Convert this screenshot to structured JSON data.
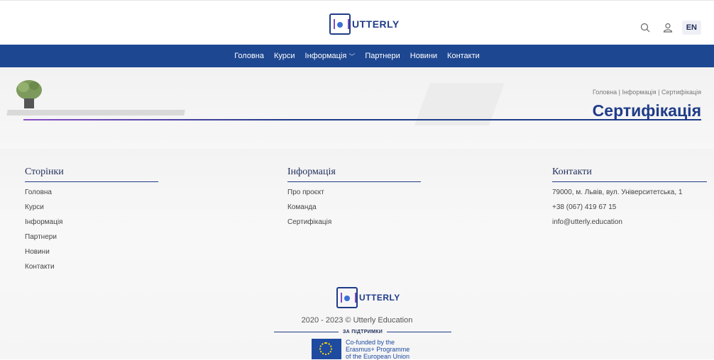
{
  "header": {
    "logo_text": "UTTERLY",
    "lang_label": "EN",
    "icons": [
      "search-icon",
      "user-icon"
    ]
  },
  "nav": {
    "items": [
      {
        "label": "Головна"
      },
      {
        "label": "Курси"
      },
      {
        "label": "Інформація",
        "has_dropdown": true
      },
      {
        "label": "Партнери"
      },
      {
        "label": "Новини"
      },
      {
        "label": "Контакти"
      }
    ]
  },
  "hero": {
    "breadcrumb": "Головна | Інформація | Сертифікація",
    "title": "Сертифікація"
  },
  "footer": {
    "col1": {
      "title": "Сторінки",
      "items": [
        "Головна",
        "Курси",
        "Інформація",
        "Партнери",
        "Новини",
        "Контакти"
      ]
    },
    "col2": {
      "title": "Інформація",
      "items": [
        "Про проєкт",
        "Команда",
        "Сертифікація"
      ]
    },
    "col3": {
      "title": "Контакти",
      "items": [
        "79000, м. Львів, вул. Університетська, 1",
        "+38 (067) 419 67 15",
        "info@utterly.education"
      ]
    },
    "logo_text": "UTTERLY",
    "copyright": "2020 - 2023 © Utterly Education",
    "support_label": "ЗА ПІДТРИМКИ",
    "eu_line1": "Co-funded by the",
    "eu_line2": "Erasmus+ Programme",
    "eu_line3": "of the European Union"
  },
  "colors": {
    "nav_bg": "#1e4791",
    "title": "#1f3c88",
    "accent_purple": "#8a4fc9"
  }
}
